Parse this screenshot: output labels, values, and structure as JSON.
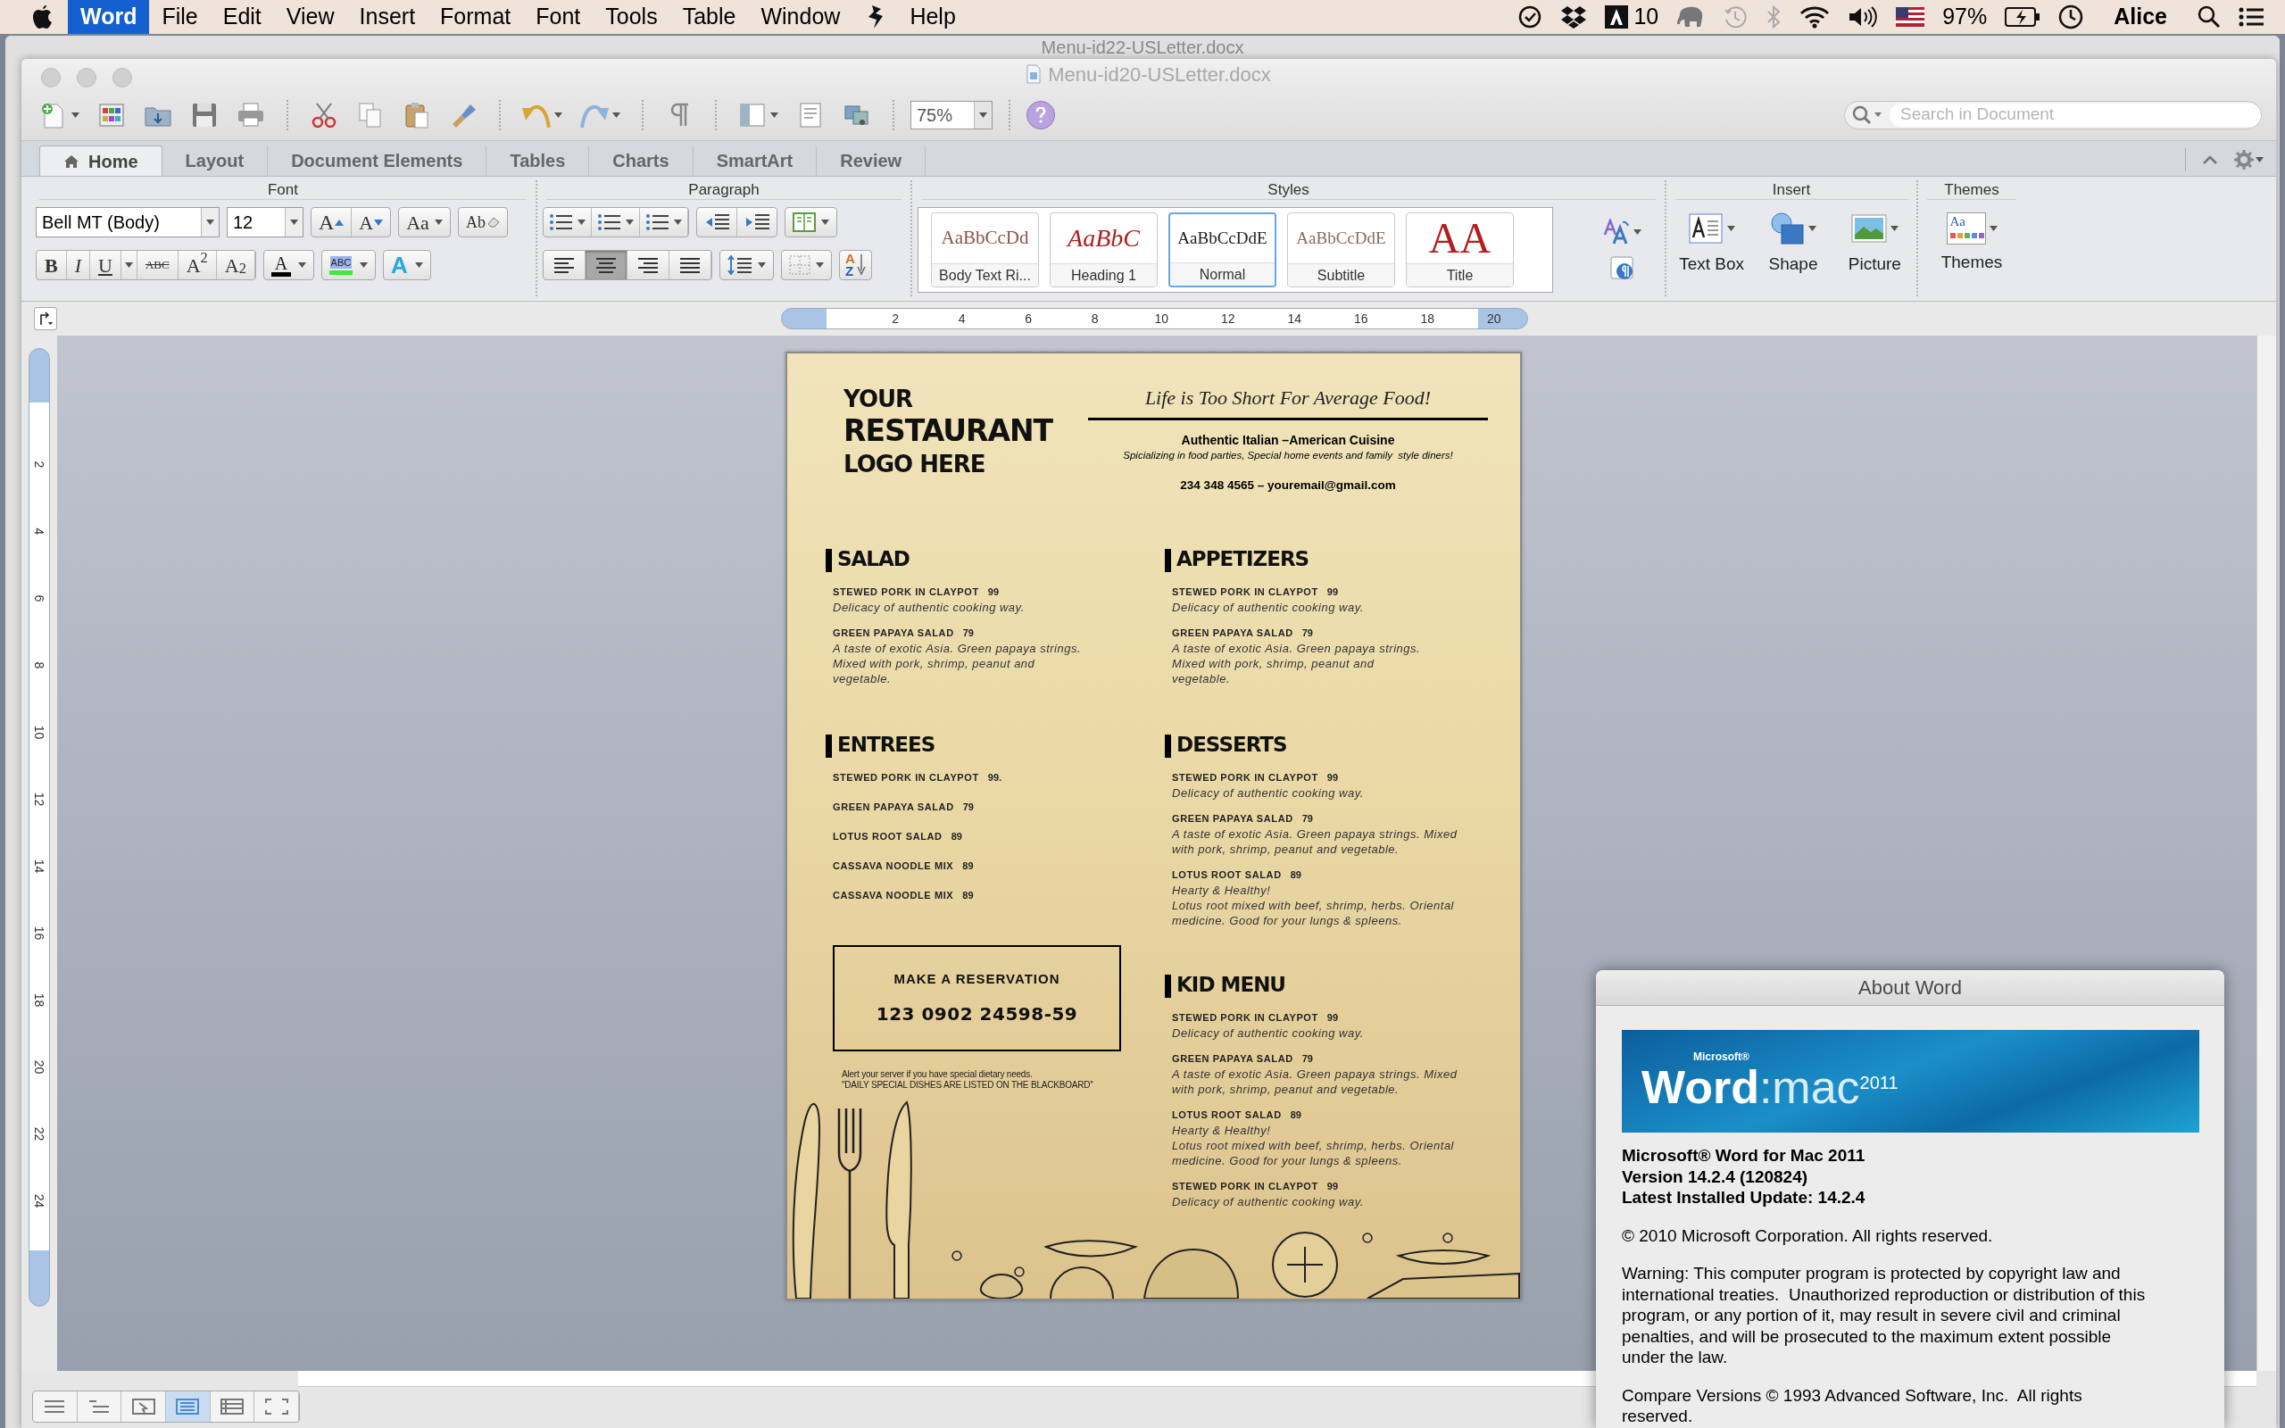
{
  "menu_bar": {
    "items": [
      {
        "label": "Word",
        "selected": true
      },
      {
        "label": "File",
        "selected": false
      },
      {
        "label": "Edit",
        "selected": false
      },
      {
        "label": "View",
        "selected": false
      },
      {
        "label": "Insert",
        "selected": false
      },
      {
        "label": "Format",
        "selected": false
      },
      {
        "label": "Font",
        "selected": false
      },
      {
        "label": "Tools",
        "selected": false
      },
      {
        "label": "Table",
        "selected": false
      },
      {
        "label": "Window",
        "selected": false
      },
      {
        "label": "Help",
        "selected": false
      }
    ],
    "status": {
      "adobe_count": "10",
      "battery": "97%",
      "user": "Alice"
    }
  },
  "background_window": {
    "title": "Menu-id22-USLetter.docx"
  },
  "window": {
    "title": "Menu-id20-USLetter.docx"
  },
  "toolbar": {
    "zoom": "75%",
    "search": {
      "placeholder": "Search in Document"
    }
  },
  "ribbon": {
    "tabs": [
      {
        "label": "Home",
        "selected": true
      },
      {
        "label": "Layout",
        "selected": false
      },
      {
        "label": "Document Elements",
        "selected": false
      },
      {
        "label": "Tables",
        "selected": false
      },
      {
        "label": "Charts",
        "selected": false
      },
      {
        "label": "SmartArt",
        "selected": false
      },
      {
        "label": "Review",
        "selected": false
      }
    ],
    "font": {
      "title": "Font",
      "font_name": "Bell MT (Body)",
      "font_size": "12",
      "grow": "A",
      "shrink": "A",
      "change_case": "Aa",
      "clear": "Ab",
      "font_color": "A",
      "highlight": "ABC",
      "effects": "A",
      "format_buttons": [
        {
          "label": "B",
          "kind": "bold"
        },
        {
          "label": "I",
          "kind": "italic"
        },
        {
          "label": "U",
          "kind": "underline"
        },
        {
          "label": "ABC",
          "kind": "strikethrough"
        },
        {
          "label": "A$^{2}$",
          "kind": "superscript"
        },
        {
          "label": "A$_{2}$",
          "kind": "subscript"
        }
      ]
    },
    "paragraph": {
      "title": "Paragraph",
      "sort": [
        "A",
        "Z"
      ],
      "alignment_buttons": [
        {
          "selected": false
        },
        {
          "selected": true
        },
        {
          "selected": false
        },
        {
          "selected": false
        }
      ]
    },
    "styles": {
      "title": "Styles",
      "items": [
        {
          "preview": "AaBbCcDd",
          "name": "Body Text Ri...",
          "kind": "body",
          "selected": false
        },
        {
          "preview": "AaBbC",
          "name": "Heading 1",
          "kind": "heading",
          "selected": false
        },
        {
          "preview": "AaBbCcDdE",
          "name": "Normal",
          "kind": "normal",
          "selected": true
        },
        {
          "preview": "AaBbCcDdE",
          "name": "Subtitle",
          "kind": "subtitle",
          "selected": false
        },
        {
          "preview": "AA",
          "name": "Title",
          "kind": "title",
          "selected": false
        }
      ]
    },
    "insert": {
      "title": "Insert",
      "items": [
        {
          "label": "Text Box",
          "kind": "textbox"
        },
        {
          "label": "Shape",
          "kind": "shape"
        },
        {
          "label": "Picture",
          "kind": "picture"
        }
      ]
    },
    "themes": {
      "title": "Themes",
      "label": "Themes",
      "preview": "Aa"
    }
  },
  "rulers": {
    "horizontal": [
      "2",
      "4",
      "6",
      "8",
      "10",
      "12",
      "14",
      "16",
      "18",
      "20"
    ],
    "vertical": [
      "2",
      "4",
      "6",
      "8",
      "10",
      "12",
      "14",
      "16",
      "18",
      "20",
      "22",
      "24"
    ]
  },
  "document": {
    "logo": [
      "YOUR",
      "RESTAURANT",
      "LOGO HERE"
    ],
    "tagline": "Life is Too Short For Average Food!",
    "cuisine": "Authentic Italian –American Cuisine",
    "specialty": "Spicializing in food parties, Special home events and family  style diners!",
    "contact": "234 348 4565 – youremail@gmail.com",
    "left_sections": [
      {
        "title": "SALAD",
        "items": [
          {
            "name": "STEWED PORK IN CLAYPOT",
            "price": "99",
            "description": [
              "Delicacy of authentic cooking way."
            ]
          },
          {
            "name": "GREEN PAPAYA SALAD",
            "price": "79",
            "description": [
              "A taste of exotic Asia. Green papaya strings. Mixed with pork, shrimp, peanut and vegetable."
            ]
          }
        ]
      },
      {
        "title": "ENTREES",
        "items": [
          {
            "name": "STEWED PORK IN CLAYPOT",
            "price": "99."
          },
          {
            "name": "GREEN PAPAYA SALAD",
            "price": "79"
          },
          {
            "name": "LOTUS ROOT SALAD",
            "price": "89"
          },
          {
            "name": "CASSAVA NOODLE MIX",
            "price": "89"
          },
          {
            "name": "CASSAVA NOODLE MIX",
            "price": "89"
          }
        ]
      }
    ],
    "reservation": {
      "title": "MAKE A RESERVATION",
      "phone": "123 0902 24598-59"
    },
    "notes": [
      "Alert your server if you have special dietary needs.",
      "\"DAILY SPECIAL DISHES ARE LISTED ON THE BLACKBOARD\""
    ],
    "right_sections": [
      {
        "title": "APPETIZERS",
        "items": [
          {
            "name": "STEWED PORK IN CLAYPOT",
            "price": "99",
            "description": [
              "Delicacy of authentic cooking way."
            ]
          },
          {
            "name": "GREEN PAPAYA SALAD",
            "price": "79",
            "description": [
              "A taste of exotic Asia. Green papaya strings. Mixed with pork, shrimp, peanut and vegetable."
            ]
          }
        ]
      },
      {
        "title": "DESSERTS",
        "items": [
          {
            "name": "STEWED PORK IN CLAYPOT",
            "price": "99",
            "description": [
              "Delicacy of authentic cooking way."
            ]
          },
          {
            "name": "GREEN PAPAYA SALAD",
            "price": "79",
            "description": [
              "A taste of exotic Asia. Green papaya strings. Mixed with pork, shrimp, peanut and vegetable."
            ]
          },
          {
            "name": "LOTUS ROOT SALAD",
            "price": "89",
            "description": [
              "Hearty & Healthy!",
              "Lotus root mixed with beef, shrimp, herbs. Oriental medicine. Good for your lungs & spleens."
            ]
          }
        ]
      },
      {
        "title": "KID MENU",
        "items": [
          {
            "name": "STEWED PORK IN CLAYPOT",
            "price": "99",
            "description": [
              "Delicacy of authentic cooking way."
            ]
          },
          {
            "name": "GREEN PAPAYA SALAD",
            "price": "79",
            "description": [
              "A taste of exotic Asia. Green papaya strings. Mixed with pork, shrimp, peanut and vegetable."
            ]
          },
          {
            "name": "LOTUS ROOT SALAD",
            "price": "89",
            "description": [
              "Hearty & Healthy!",
              "Lotus root mixed with beef, shrimp, herbs. Oriental medicine. Good for your lungs & spleens."
            ]
          },
          {
            "name": "STEWED PORK IN CLAYPOT",
            "price": "99",
            "description": [
              "Delicacy of authentic cooking way."
            ]
          }
        ]
      }
    ]
  },
  "view_buttons": [
    {
      "selected": false
    },
    {
      "selected": false
    },
    {
      "selected": false
    },
    {
      "selected": true
    },
    {
      "selected": false
    },
    {
      "selected": false
    }
  ],
  "about_dialog": {
    "title": "About Word",
    "banner": {
      "brand": "Microsoft®",
      "product": "Word",
      "platform": ":mac",
      "year": "2011"
    },
    "product_lines": [
      "Microsoft® Word for Mac 2011",
      "Version 14.2.4 (120824)",
      "Latest Installed Update: 14.2.4"
    ],
    "copyright": "© 2010 Microsoft Corporation. All rights reserved.",
    "warning": "Warning: This computer program is protected by copyright law and international treaties.  Unauthorized reproduction or distribution of this program, or any portion of it, may result in severe civil and criminal penalties, and will be prosecuted to the maximum extent possible under the law.",
    "compare": "Compare Versions © 1993 Advanced Software, Inc.  All rights reserved."
  }
}
